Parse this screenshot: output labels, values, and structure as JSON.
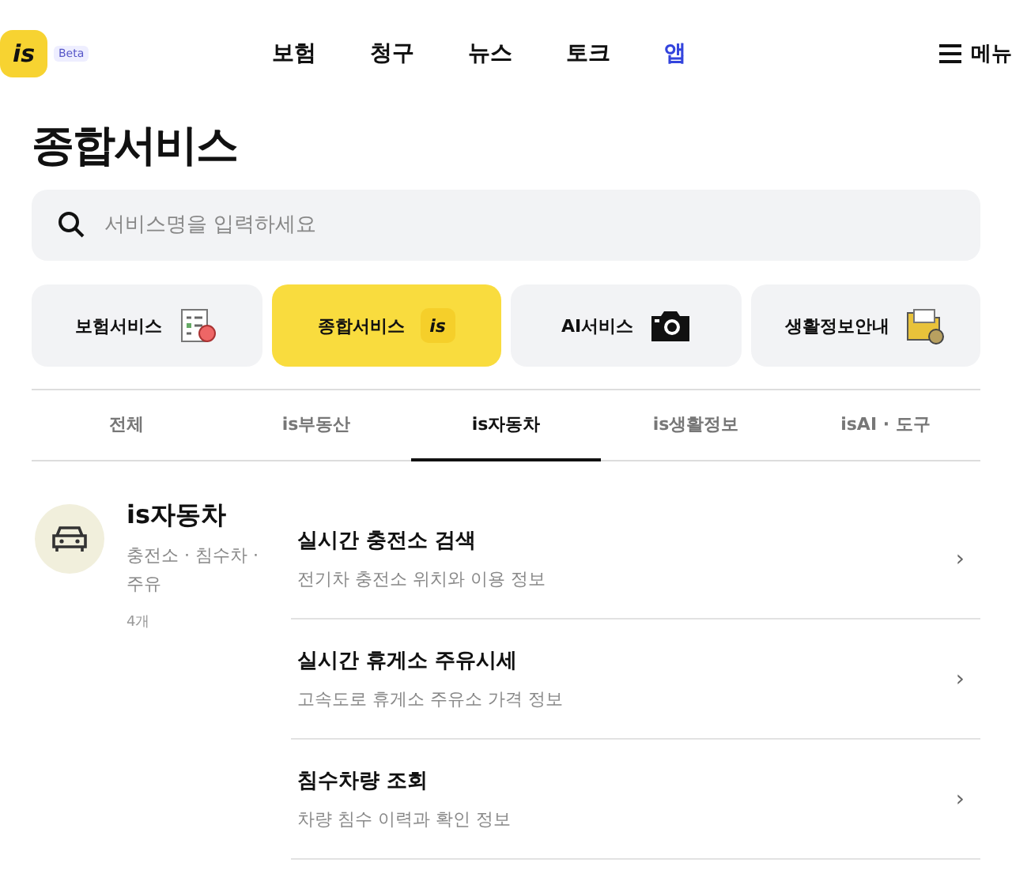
{
  "header": {
    "logo": "is",
    "badge": "Beta",
    "nav": [
      {
        "label": "보험",
        "selected": false
      },
      {
        "label": "청구",
        "selected": false
      },
      {
        "label": "뉴스",
        "selected": false
      },
      {
        "label": "토크",
        "selected": false
      },
      {
        "label": "앱",
        "selected": true
      }
    ],
    "menu": "메뉴"
  },
  "title": "종합서비스",
  "search": {
    "placeholder": "서비스명을 입력하세요"
  },
  "categories": [
    {
      "label": "보험서비스",
      "kind": "document",
      "selected": false
    },
    {
      "label": "종합서비스",
      "kind": "logo",
      "logo": "is",
      "selected": true
    },
    {
      "label": "AI서비스",
      "kind": "camera",
      "selected": false
    },
    {
      "label": "생활정보안내",
      "kind": "folder",
      "selected": false
    }
  ],
  "tabs": [
    {
      "label": "전체",
      "selected": false
    },
    {
      "label": "is부동산",
      "selected": false
    },
    {
      "label": "is자동차",
      "selected": true
    },
    {
      "label": "is생활정보",
      "selected": false
    },
    {
      "label": "isAI · 도구",
      "selected": false
    }
  ],
  "section": {
    "title": "is자동차",
    "subtitle": "충전소 · 침수차 · 주유",
    "count": "4개"
  },
  "items": [
    {
      "title": "실시간 충전소 검색",
      "desc": "전기차 충전소 위치와 이용 정보",
      "chevron": "›"
    },
    {
      "title": "실시간 휴게소 주유시세",
      "desc": "고속도로 휴게소 주유소 가격 정보",
      "chevron": "›"
    },
    {
      "title": "침수차량 조회",
      "desc": "차량 침수 이력과 확인 정보",
      "chevron": "›"
    }
  ]
}
